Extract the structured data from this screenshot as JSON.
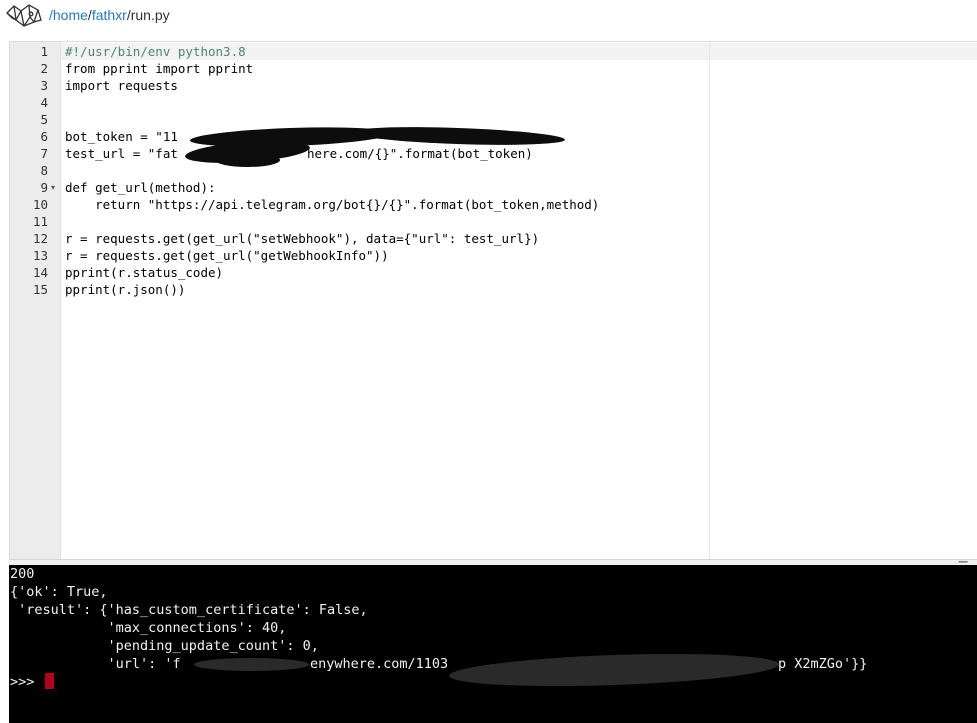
{
  "header": {
    "breadcrumb": [
      {
        "label": "/home",
        "link": true
      },
      {
        "label": "/",
        "link": false
      },
      {
        "label": "fathxr",
        "link": true
      },
      {
        "label": "/run.py",
        "link": false
      }
    ]
  },
  "editor": {
    "line_numbers": [
      "1",
      "2",
      "3",
      "4",
      "5",
      "6",
      "7",
      "8",
      "9",
      "10",
      "11",
      "12",
      "13",
      "14",
      "15"
    ],
    "lines": [
      "#!/usr/bin/env python3.8",
      "from pprint import pprint",
      "import requests",
      "",
      "",
      "bot_token = \"11",
      "test_url = \"fat",
      "",
      "def get_url(method):",
      "    return \"https://api.telegram.org/bot{}/{}\".format(bot_token,method)",
      "",
      "r = requests.get(get_url(\"setWebhook\"), data={\"url\": test_url})",
      "r = requests.get(get_url(\"getWebhookInfo\"))",
      "pprint(r.status_code)",
      "pprint(r.json())"
    ],
    "line7_tail": "here.com/{}\".format(bot_token)",
    "line6_frag1": "T",
    "line6_frag2": "1",
    "fold_marker": "▾"
  },
  "console": {
    "lines": [
      "200",
      "{'ok': True,",
      " 'result': {'has_custom_certificate': False,",
      "            'max_connections': 40,",
      "            'pending_update_count': 0,",
      "            'url': 'f"
    ],
    "url_frag": "enywhere.com/1103",
    "url_end": "p X2mZGo'}}",
    "prompt": ">>> "
  },
  "colors": {
    "link": "#1f79c4",
    "console_bg": "#000000",
    "cursor": "#b3001b"
  }
}
